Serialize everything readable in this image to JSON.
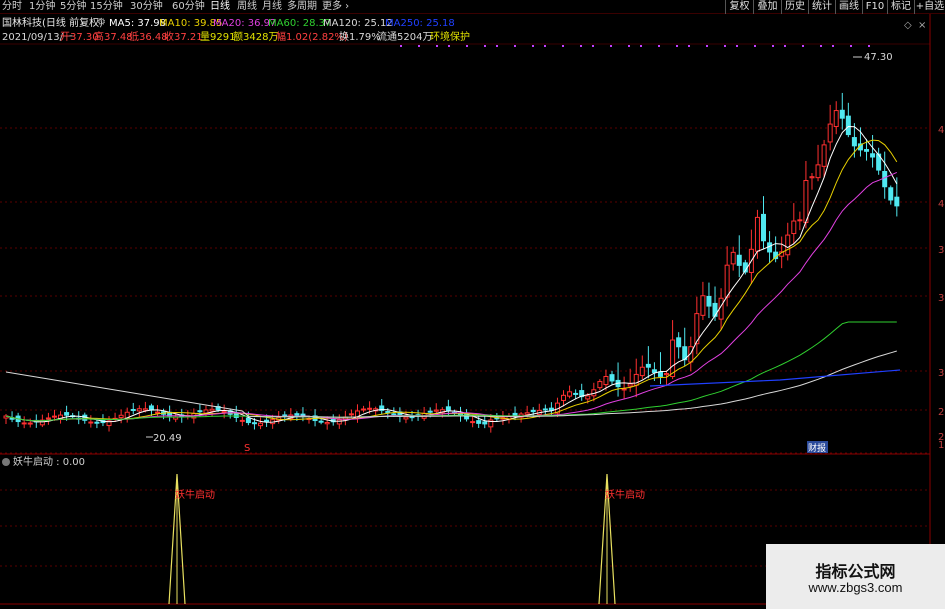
{
  "period_tabs": [
    {
      "label": "分时"
    },
    {
      "label": "1分钟"
    },
    {
      "label": "5分钟"
    },
    {
      "label": "15分钟"
    },
    {
      "label": "30分钟"
    },
    {
      "label": "60分钟"
    },
    {
      "label": "日线",
      "active": true
    },
    {
      "label": "周线"
    },
    {
      "label": "月线"
    },
    {
      "label": "多周期"
    },
    {
      "label": "更多"
    }
  ],
  "right_buttons": [
    "复权",
    "叠加",
    "历史",
    "统计",
    "画线",
    "F10",
    "标记",
    "+自选"
  ],
  "stock": {
    "name": "国林科技(日线 前复权)"
  },
  "ma": {
    "ma5": {
      "label": "MA5: 37.98",
      "color": "#ffffff"
    },
    "ma10": {
      "label": "MA10: 39.85",
      "color": "#e8d000"
    },
    "ma20": {
      "label": "MA20: 36.97",
      "color": "#e040e0"
    },
    "ma60": {
      "label": "MA60: 28.37",
      "color": "#30d030"
    },
    "ma120": {
      "label": "MA120: 25.12",
      "color": "#d8d8d8"
    },
    "ma250": {
      "label": "MA250: 25.18",
      "color": "#2040ff"
    }
  },
  "day": {
    "date": "2021/09/13/一",
    "open": "开37.30",
    "high": "高37.48",
    "low": "低36.48",
    "close": "收37.21",
    "volume": "量9291",
    "amount": "额3428万",
    "change": "幅1.02(2.82%)",
    "turnover": "换1.79%",
    "float": "流通5204万",
    "concept": "环境保护"
  },
  "annotations": {
    "max_price": "47.30",
    "min_price": "20.49",
    "event_s": "S",
    "event_report": "财报"
  },
  "right_axis_ticks": [
    "4",
    "4",
    "3",
    "3",
    "3",
    "2",
    "2",
    "1"
  ],
  "indicator": {
    "title": "妖牛启动 : 0.00",
    "signal_label": "妖牛启动",
    "signals": [
      {
        "label": "妖牛启动"
      },
      {
        "label": "妖牛启动"
      }
    ]
  },
  "watermark": {
    "title": "指标公式网",
    "url": "www.zbgs3.com"
  }
}
